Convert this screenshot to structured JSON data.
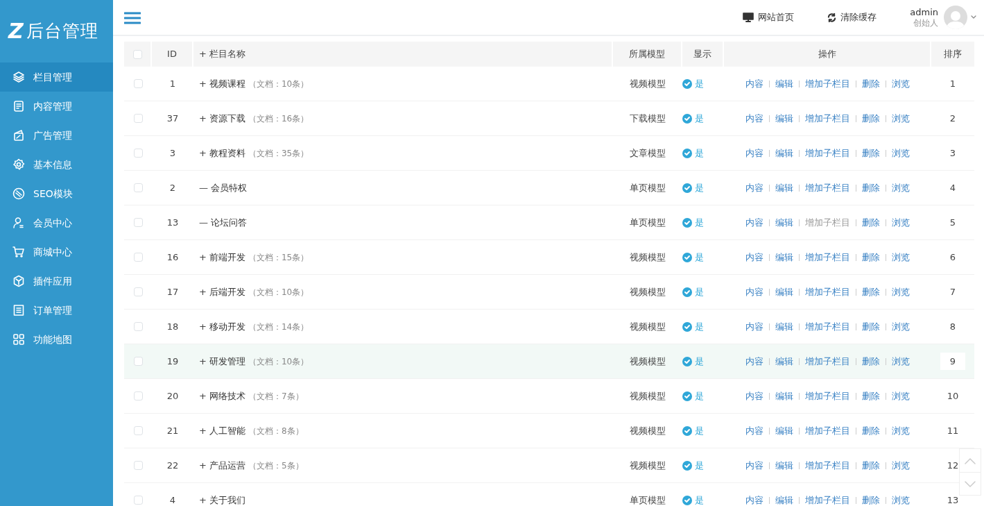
{
  "sidebar": {
    "logo_mark": "Z",
    "logo_text": "后台管理",
    "items": [
      {
        "label": "栏目管理",
        "selected": true
      },
      {
        "label": "内容管理",
        "selected": false
      },
      {
        "label": "广告管理",
        "selected": false
      },
      {
        "label": "基本信息",
        "selected": false
      },
      {
        "label": "SEO模块",
        "selected": false
      },
      {
        "label": "会员中心",
        "selected": false
      },
      {
        "label": "商城中心",
        "selected": false
      },
      {
        "label": "插件应用",
        "selected": false
      },
      {
        "label": "订单管理",
        "selected": false
      },
      {
        "label": "功能地图",
        "selected": false
      }
    ]
  },
  "header": {
    "links": [
      {
        "label": "网站首页"
      },
      {
        "label": "清除缓存"
      }
    ],
    "user": {
      "name": "admin",
      "role": "创始人"
    }
  },
  "table": {
    "header": {
      "select_all_checked": false,
      "id": "ID",
      "name_toggle": "+",
      "name": "栏目名称",
      "model": "所属模型",
      "display": "显示",
      "actions": "操作",
      "sort": "排序"
    },
    "rows": [
      {
        "checked": false,
        "id": "1",
        "toggle": "+",
        "name": "视频课程",
        "docs": "（文档：10条）",
        "model": "视频模型",
        "shown": true,
        "display": "是",
        "actions": [
          {
            "label": "内容",
            "disabled": false
          },
          {
            "label": "编辑",
            "disabled": false
          },
          {
            "label": "增加子栏目",
            "disabled": false
          },
          {
            "label": "删除",
            "disabled": false
          },
          {
            "label": "浏览",
            "disabled": false
          }
        ],
        "sort": "1",
        "highlighted": false
      },
      {
        "checked": false,
        "id": "37",
        "toggle": "+",
        "name": "资源下载",
        "docs": "（文档：16条）",
        "model": "下载模型",
        "shown": true,
        "display": "是",
        "actions": [
          {
            "label": "内容",
            "disabled": false
          },
          {
            "label": "编辑",
            "disabled": false
          },
          {
            "label": "增加子栏目",
            "disabled": false
          },
          {
            "label": "删除",
            "disabled": false
          },
          {
            "label": "浏览",
            "disabled": false
          }
        ],
        "sort": "2",
        "highlighted": false
      },
      {
        "checked": false,
        "id": "3",
        "toggle": "+",
        "name": "教程资料",
        "docs": "（文档：35条）",
        "model": "文章模型",
        "shown": true,
        "display": "是",
        "actions": [
          {
            "label": "内容",
            "disabled": false
          },
          {
            "label": "编辑",
            "disabled": false
          },
          {
            "label": "增加子栏目",
            "disabled": false
          },
          {
            "label": "删除",
            "disabled": false
          },
          {
            "label": "浏览",
            "disabled": false
          }
        ],
        "sort": "3",
        "highlighted": false
      },
      {
        "checked": false,
        "id": "2",
        "toggle": "—",
        "name": "会员特权",
        "model": "单页模型",
        "shown": true,
        "display": "是",
        "actions": [
          {
            "label": "内容",
            "disabled": false
          },
          {
            "label": "编辑",
            "disabled": false
          },
          {
            "label": "增加子栏目",
            "disabled": false
          },
          {
            "label": "删除",
            "disabled": false
          },
          {
            "label": "浏览",
            "disabled": false
          }
        ],
        "sort": "4",
        "highlighted": false
      },
      {
        "checked": false,
        "id": "13",
        "toggle": "—",
        "name": "论坛问答",
        "model": "单页模型",
        "shown": true,
        "display": "是",
        "actions": [
          {
            "label": "内容",
            "disabled": false
          },
          {
            "label": "编辑",
            "disabled": false
          },
          {
            "label": "增加子栏目",
            "disabled": true
          },
          {
            "label": "删除",
            "disabled": false
          },
          {
            "label": "浏览",
            "disabled": false
          }
        ],
        "sort": "5",
        "highlighted": false
      },
      {
        "checked": false,
        "id": "16",
        "toggle": "+",
        "name": "前端开发",
        "docs": "（文档：15条）",
        "model": "视频模型",
        "shown": true,
        "display": "是",
        "actions": [
          {
            "label": "内容",
            "disabled": false
          },
          {
            "label": "编辑",
            "disabled": false
          },
          {
            "label": "增加子栏目",
            "disabled": false
          },
          {
            "label": "删除",
            "disabled": false
          },
          {
            "label": "浏览",
            "disabled": false
          }
        ],
        "sort": "6",
        "highlighted": false
      },
      {
        "checked": false,
        "id": "17",
        "toggle": "+",
        "name": "后端开发",
        "docs": "（文档：10条）",
        "model": "视频模型",
        "shown": true,
        "display": "是",
        "actions": [
          {
            "label": "内容",
            "disabled": false
          },
          {
            "label": "编辑",
            "disabled": false
          },
          {
            "label": "增加子栏目",
            "disabled": false
          },
          {
            "label": "删除",
            "disabled": false
          },
          {
            "label": "浏览",
            "disabled": false
          }
        ],
        "sort": "7",
        "highlighted": false
      },
      {
        "checked": false,
        "id": "18",
        "toggle": "+",
        "name": "移动开发",
        "docs": "（文档：14条）",
        "model": "视频模型",
        "shown": true,
        "display": "是",
        "actions": [
          {
            "label": "内容",
            "disabled": false
          },
          {
            "label": "编辑",
            "disabled": false
          },
          {
            "label": "增加子栏目",
            "disabled": false
          },
          {
            "label": "删除",
            "disabled": false
          },
          {
            "label": "浏览",
            "disabled": false
          }
        ],
        "sort": "8",
        "highlighted": false
      },
      {
        "checked": false,
        "id": "19",
        "toggle": "+",
        "name": "研发管理",
        "docs": "（文档：10条）",
        "model": "视频模型",
        "shown": true,
        "display": "是",
        "actions": [
          {
            "label": "内容",
            "disabled": false
          },
          {
            "label": "编辑",
            "disabled": false
          },
          {
            "label": "增加子栏目",
            "disabled": false
          },
          {
            "label": "删除",
            "disabled": false
          },
          {
            "label": "浏览",
            "disabled": false
          }
        ],
        "sort": "9",
        "highlighted": true
      },
      {
        "checked": false,
        "id": "20",
        "toggle": "+",
        "name": "网络技术",
        "docs": "（文档：7条）",
        "model": "视频模型",
        "shown": true,
        "display": "是",
        "actions": [
          {
            "label": "内容",
            "disabled": false
          },
          {
            "label": "编辑",
            "disabled": false
          },
          {
            "label": "增加子栏目",
            "disabled": false
          },
          {
            "label": "删除",
            "disabled": false
          },
          {
            "label": "浏览",
            "disabled": false
          }
        ],
        "sort": "10",
        "highlighted": false
      },
      {
        "checked": false,
        "id": "21",
        "toggle": "+",
        "name": "人工智能",
        "docs": "（文档：8条）",
        "model": "视频模型",
        "shown": true,
        "display": "是",
        "actions": [
          {
            "label": "内容",
            "disabled": false
          },
          {
            "label": "编辑",
            "disabled": false
          },
          {
            "label": "增加子栏目",
            "disabled": false
          },
          {
            "label": "删除",
            "disabled": false
          },
          {
            "label": "浏览",
            "disabled": false
          }
        ],
        "sort": "11",
        "highlighted": false
      },
      {
        "checked": false,
        "id": "22",
        "toggle": "+",
        "name": "产品运营",
        "docs": "（文档：5条）",
        "model": "视频模型",
        "shown": true,
        "display": "是",
        "actions": [
          {
            "label": "内容",
            "disabled": false
          },
          {
            "label": "编辑",
            "disabled": false
          },
          {
            "label": "增加子栏目",
            "disabled": false
          },
          {
            "label": "删除",
            "disabled": false
          },
          {
            "label": "浏览",
            "disabled": false
          }
        ],
        "sort": "12",
        "highlighted": false
      },
      {
        "checked": false,
        "id": "4",
        "toggle": "+",
        "name": "关于我们",
        "model": "单页模型",
        "shown": true,
        "display": "是",
        "actions": [
          {
            "label": "内容",
            "disabled": false
          },
          {
            "label": "编辑",
            "disabled": false
          },
          {
            "label": "增加子栏目",
            "disabled": false
          },
          {
            "label": "删除",
            "disabled": false
          },
          {
            "label": "浏览",
            "disabled": false
          }
        ],
        "sort": "13",
        "highlighted": false
      }
    ]
  }
}
